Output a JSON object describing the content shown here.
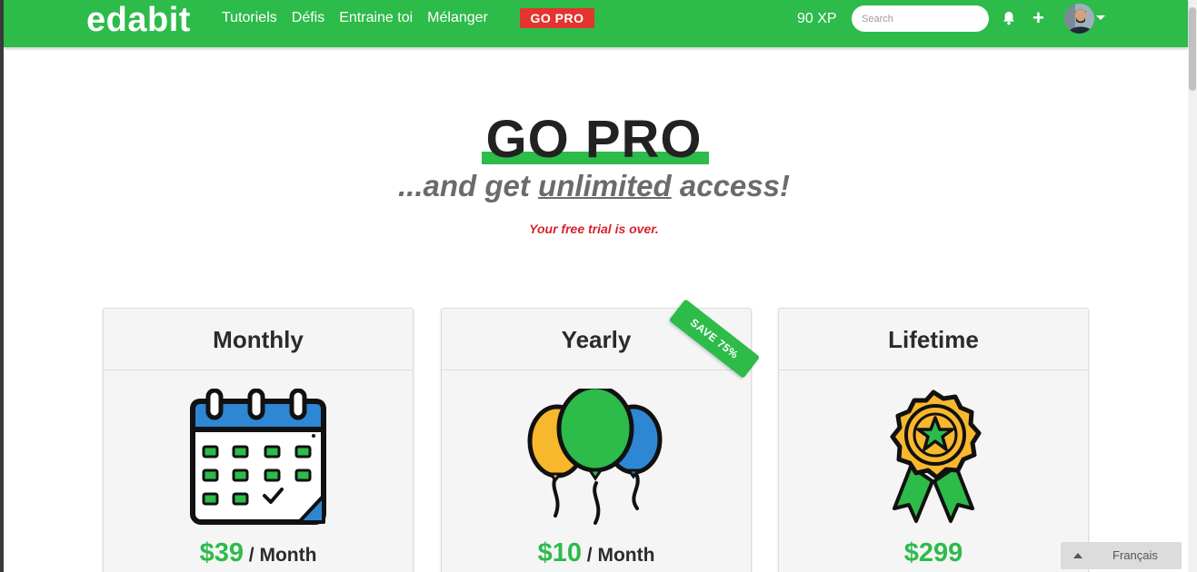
{
  "nav": {
    "logo": "edabit",
    "links": [
      "Tutoriels",
      "Défis",
      "Entraine toi",
      "Mélanger"
    ],
    "gopro": "GO PRO",
    "xp": "90 XP",
    "search_placeholder": "Search",
    "icons": [
      "bell-icon",
      "plus-icon",
      "avatar",
      "chevron-down-icon"
    ]
  },
  "hero": {
    "title": "GO PRO",
    "subtitle_pre": "...and get ",
    "subtitle_em": "unlimited",
    "subtitle_post": " access!",
    "trial_notice": "Your free trial is over."
  },
  "plans": [
    {
      "name": "Monthly",
      "price": "$39",
      "period": " / Month",
      "icon": "calendar-icon"
    },
    {
      "name": "Yearly",
      "price": "$10",
      "period": " / Month",
      "icon": "balloons-icon",
      "ribbon": "SAVE 75%"
    },
    {
      "name": "Lifetime",
      "price": "$299",
      "period": "",
      "icon": "award-medal-icon"
    }
  ],
  "language": {
    "label": "Français"
  },
  "colors": {
    "brand_green": "#2dbb4a",
    "gopro_red": "#e3342f",
    "trial_red": "#d9232d"
  }
}
